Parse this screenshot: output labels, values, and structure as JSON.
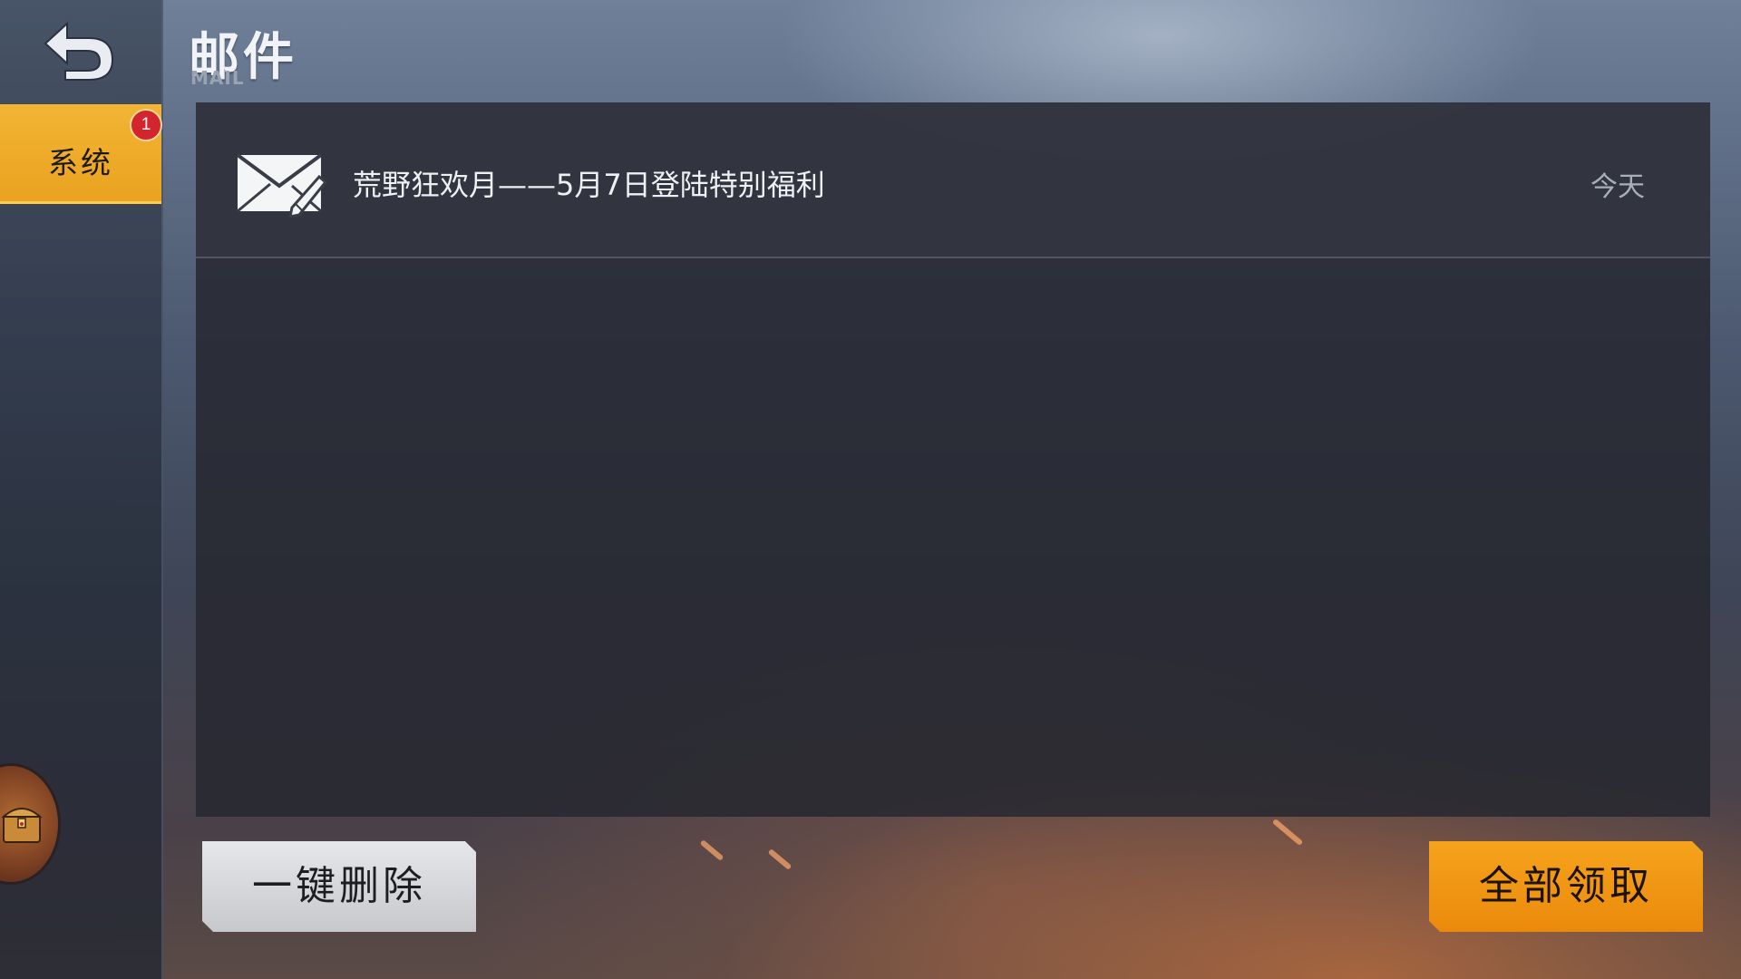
{
  "header": {
    "title": "邮件",
    "subtitle": "MAIL",
    "back_icon": "back-arrow-icon"
  },
  "sidebar": {
    "tabs": [
      {
        "label": "系统",
        "badge": "1",
        "selected": true
      }
    ],
    "chest_icon": "treasure-chest-icon"
  },
  "mail_list": {
    "items": [
      {
        "icon": "envelope-icon",
        "subject": "荒野狂欢月——5月7日登陆特别福利",
        "date": "今天"
      }
    ]
  },
  "actions": {
    "delete_all_label": "一键删除",
    "claim_all_label": "全部领取"
  },
  "colors": {
    "accent": "#eea21c",
    "badge": "#d3262c",
    "panel": "#26282f"
  }
}
